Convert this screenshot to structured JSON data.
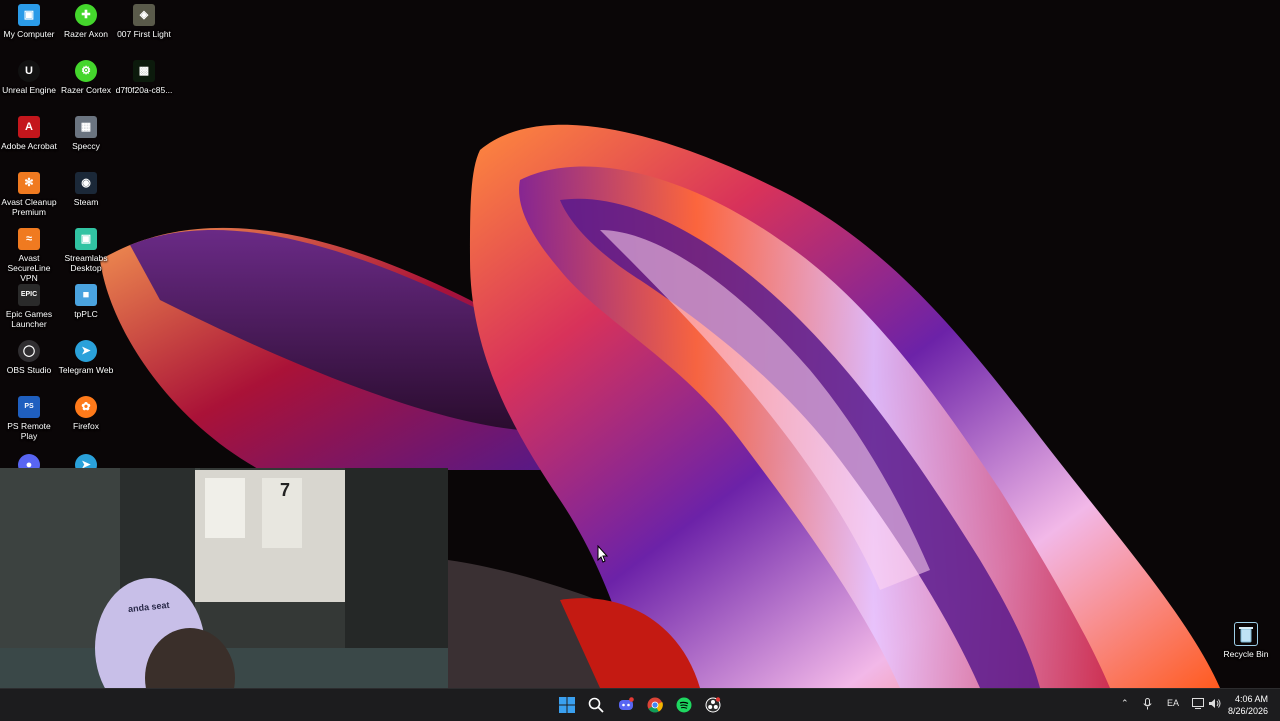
{
  "desktop": {
    "icons": [
      {
        "label": "My Computer",
        "icon": "computer-icon",
        "color": "#2b9be8"
      },
      {
        "label": "Razer Axon",
        "icon": "razer-axon-icon",
        "color": "#44d62c"
      },
      {
        "label": "007 First Light",
        "icon": "game-007-icon",
        "color": "#5a5a4a"
      },
      {
        "label": "Unreal Engine",
        "icon": "unreal-engine-icon",
        "color": "#111111"
      },
      {
        "label": "Razer Cortex",
        "icon": "razer-cortex-icon",
        "color": "#44d62c"
      },
      {
        "label": "d7f0f20a-c85...",
        "icon": "file-icon",
        "color": "#0c1a0c"
      },
      {
        "label": "Adobe Acrobat",
        "icon": "acrobat-icon",
        "color": "#c4161c"
      },
      {
        "label": "Speccy",
        "icon": "speccy-icon",
        "color": "#6b7480"
      },
      {
        "label": "Avast Cleanup Premium",
        "icon": "avast-cleanup-icon",
        "color": "#f07a20"
      },
      {
        "label": "Steam",
        "icon": "steam-icon",
        "color": "#1b2838"
      },
      {
        "label": "Avast SecureLine VPN",
        "icon": "avast-vpn-icon",
        "color": "#f07a20"
      },
      {
        "label": "Streamlabs Desktop",
        "icon": "streamlabs-icon",
        "color": "#31c3a2"
      },
      {
        "label": "Epic Games Launcher",
        "icon": "epic-games-icon",
        "color": "#2a2a2a"
      },
      {
        "label": "tpPLC",
        "icon": "tpplc-icon",
        "color": "#4aa3df"
      },
      {
        "label": "OBS Studio",
        "icon": "obs-icon",
        "color": "#302e31"
      },
      {
        "label": "Telegram Web",
        "icon": "telegram-icon",
        "color": "#2aa1da"
      },
      {
        "label": "PS Remote Play",
        "icon": "ps-remote-play-icon",
        "color": "#1f5fbf"
      },
      {
        "label": "Firefox",
        "icon": "firefox-icon",
        "color": "#ff7a1a"
      },
      {
        "label": "Recycle Bin",
        "icon": "recycle-bin-icon",
        "color": "#9ecfe8"
      }
    ],
    "partial_icons": [
      {
        "icon": "discord-icon",
        "color": "#5865f2"
      },
      {
        "icon": "telegram-icon",
        "color": "#2aa1da"
      }
    ]
  },
  "webcam": {
    "chair_text": "anda seat",
    "jersey_number": "7"
  },
  "taskbar": {
    "apps": [
      {
        "icon": "windows-start-icon",
        "color": "#3aa0f0"
      },
      {
        "icon": "search-icon",
        "color": "#ffffff"
      },
      {
        "icon": "discord-icon",
        "color": "#5865f2"
      },
      {
        "icon": "chrome-icon",
        "color": "#4caf50"
      },
      {
        "icon": "spotify-icon",
        "color": "#1ed760"
      },
      {
        "icon": "obs-icon",
        "color": "#ffffff"
      }
    ],
    "tray": {
      "language": "EA",
      "time": "4:06 AM",
      "date": "8/26/2026"
    }
  }
}
